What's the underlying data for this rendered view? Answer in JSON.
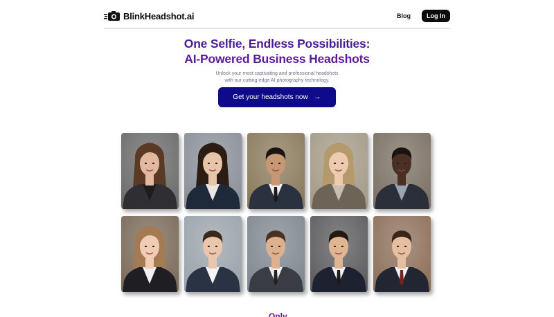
{
  "nav": {
    "brand_name": "BlinkHeadshot.ai",
    "logo_icon": "camera-speed-icon",
    "blog_label": "Blog",
    "login_label": "Log In"
  },
  "hero": {
    "headline_line1": "One Selfie, Endless Possibilities:",
    "headline_line2": "AI-Powered Business Headshots",
    "subtext_line1": "Unlock your most captivating and professional headshots",
    "subtext_line2": "with our cutting-edge AI photography technology.",
    "cta_label": "Get your headshots now",
    "cta_icon": "arrow-right-icon"
  },
  "colors": {
    "headline": "#5b1b9a",
    "cta_bg": "#0f0a8a",
    "login_bg": "#0b0b0b"
  },
  "gallery": {
    "photos": [
      {
        "subject": "woman",
        "bg": "#6b6b6b",
        "skin": "#e2b9a0",
        "hair": "#5a3a24",
        "suit": "#2f2f33",
        "shirt": "#1c1c1c",
        "tie": null
      },
      {
        "subject": "woman",
        "bg": "#8a8f98",
        "skin": "#e8c4a8",
        "hair": "#2b1c14",
        "suit": "#1e2a3a",
        "shirt": "#e9e6e3",
        "tie": null
      },
      {
        "subject": "man",
        "bg": "#8a7a5c",
        "skin": "#c89876",
        "hair": "#1a1410",
        "suit": "#2a3240",
        "shirt": "#f2f2f2",
        "tie": "#1a1a1a"
      },
      {
        "subject": "woman",
        "bg": "#a49a88",
        "skin": "#edcab0",
        "hair": "#b59a6e",
        "suit": "#6e6357",
        "shirt": "#c9bfb0",
        "tie": null
      },
      {
        "subject": "man",
        "bg": "#7b7064",
        "skin": "#4a3024",
        "hair": "#1a1210",
        "suit": "#2b2f3a",
        "shirt": "#9aa3b0",
        "tie": null
      },
      {
        "subject": "woman",
        "bg": "#7a6a5a",
        "skin": "#efcdb4",
        "hair": "#a37a52",
        "suit": "#1f1f23",
        "shirt": "#f0f0f0",
        "tie": null
      },
      {
        "subject": "man",
        "bg": "#9aa3ab",
        "skin": "#e9c6ac",
        "hair": "#3a2a1e",
        "suit": "#2a3344",
        "shirt": "#f4f4f4",
        "tie": null
      },
      {
        "subject": "man",
        "bg": "#7f8790",
        "skin": "#ddb090",
        "hair": "#4a3222",
        "suit": "#3a3d44",
        "shirt": "#f2f2f2",
        "tie": "#222"
      },
      {
        "subject": "man",
        "bg": "#5c5c5e",
        "skin": "#e0b592",
        "hair": "#241912",
        "suit": "#1e2230",
        "shirt": "#f2f2f2",
        "tie": "#1a1a1a"
      },
      {
        "subject": "man",
        "bg": "#8d6f5a",
        "skin": "#e6bfa2",
        "hair": "#3a2618",
        "suit": "#222633",
        "shirt": "#f2f2f2",
        "tie": "#7a2222"
      }
    ]
  },
  "teaser": {
    "text": "Only"
  }
}
